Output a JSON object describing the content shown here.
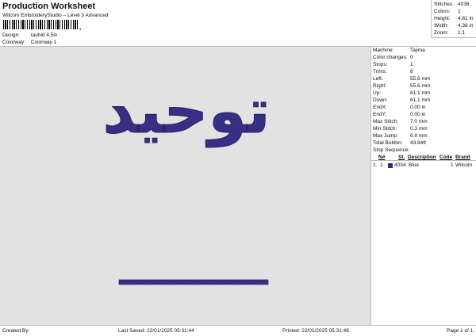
{
  "header": {
    "title": "Production Worksheet",
    "subtitle": "Wilcom EmbroideryStudio – Level 3 Advanced",
    "barcode_mark": ",",
    "design_label": "Design:",
    "design_value": "tauhid 4,5in",
    "colorway_label": "Colorway:",
    "colorway_value": "Colorway 1"
  },
  "stats": [
    {
      "label": "Stitches:",
      "value": "4036"
    },
    {
      "label": "Colors:",
      "value": "1"
    },
    {
      "label": "Height:",
      "value": "4.81 in"
    },
    {
      "label": "Width:",
      "value": "4.38 in"
    },
    {
      "label": "Zoom:",
      "value": "1:1"
    }
  ],
  "machine_info": [
    {
      "label": "Machine:",
      "value": "Tajima"
    },
    {
      "label": "Color changes:",
      "value": "0"
    },
    {
      "label": "Stops:",
      "value": "1"
    },
    {
      "label": "Trims:",
      "value": "8"
    },
    {
      "label": "Left:",
      "value": "55.6 mm"
    },
    {
      "label": "Right:",
      "value": "55.6 mm"
    },
    {
      "label": "Up:",
      "value": "61.1 mm"
    },
    {
      "label": "Down:",
      "value": "61.1 mm"
    },
    {
      "label": "EndX:",
      "value": "0.00 in"
    },
    {
      "label": "EndY:",
      "value": "0.00 in"
    },
    {
      "label": "Max Stitch:",
      "value": "7.0 mm"
    },
    {
      "label": "Min Stitch:",
      "value": "0.3 mm"
    },
    {
      "label": "Max Jump:",
      "value": "6.8 mm"
    },
    {
      "label": "Total Bobbin:",
      "value": "43.84ft"
    }
  ],
  "stop_sequence": {
    "label": "Stop Sequence:",
    "columns": [
      "N#",
      "St.",
      "Description",
      "Code",
      "Brand"
    ],
    "rows": [
      {
        "stop": "1.",
        "n": "1",
        "stitches": "4034",
        "description": "Blue",
        "code": "1",
        "brand": "Wilcom",
        "color": "#2f2a78"
      }
    ]
  },
  "design": {
    "text": "توحيد",
    "thread_color": "#3d3590"
  },
  "footer": {
    "created_by": "Created By:",
    "last_saved": "Last Saved: 22/01/2025 05:31:44",
    "printed": "Printed: 22/01/2025 05:31:48",
    "page": "Page 1 of 1"
  }
}
